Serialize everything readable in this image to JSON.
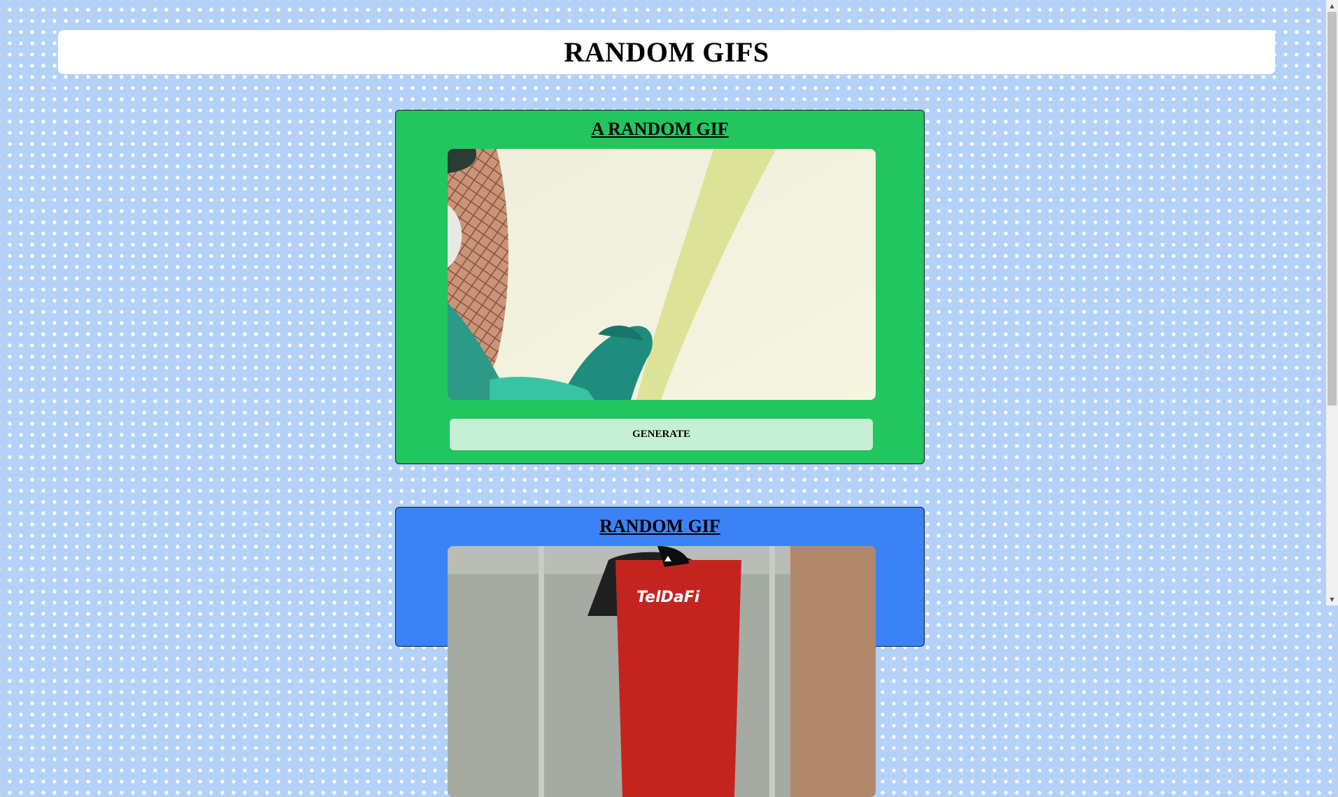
{
  "header": {
    "title": "RANDOM GIFS"
  },
  "cards": [
    {
      "title": "A RANDOM GIF",
      "button_label": "GENERATE",
      "accent": "#22c55e"
    },
    {
      "title": "RANDOM GIF",
      "accent": "#3b82f6"
    }
  ],
  "gif_text": {
    "jersey": "TelDaFi"
  },
  "colors": {
    "page_bg": "#b4d1f8",
    "button_bg": "#c6f0d6"
  },
  "scrollbar": {
    "up_icon": "triangle-up-icon",
    "down_icon": "triangle-down-icon"
  }
}
